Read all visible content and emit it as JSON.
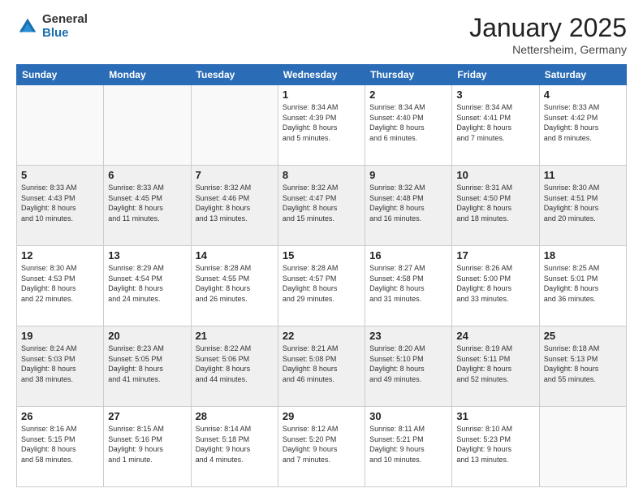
{
  "logo": {
    "general": "General",
    "blue": "Blue"
  },
  "title": {
    "month": "January 2025",
    "location": "Nettersheim, Germany"
  },
  "days_header": [
    "Sunday",
    "Monday",
    "Tuesday",
    "Wednesday",
    "Thursday",
    "Friday",
    "Saturday"
  ],
  "weeks": [
    {
      "alt": false,
      "days": [
        {
          "num": "",
          "info": ""
        },
        {
          "num": "",
          "info": ""
        },
        {
          "num": "",
          "info": ""
        },
        {
          "num": "1",
          "info": "Sunrise: 8:34 AM\nSunset: 4:39 PM\nDaylight: 8 hours\nand 5 minutes."
        },
        {
          "num": "2",
          "info": "Sunrise: 8:34 AM\nSunset: 4:40 PM\nDaylight: 8 hours\nand 6 minutes."
        },
        {
          "num": "3",
          "info": "Sunrise: 8:34 AM\nSunset: 4:41 PM\nDaylight: 8 hours\nand 7 minutes."
        },
        {
          "num": "4",
          "info": "Sunrise: 8:33 AM\nSunset: 4:42 PM\nDaylight: 8 hours\nand 8 minutes."
        }
      ]
    },
    {
      "alt": true,
      "days": [
        {
          "num": "5",
          "info": "Sunrise: 8:33 AM\nSunset: 4:43 PM\nDaylight: 8 hours\nand 10 minutes."
        },
        {
          "num": "6",
          "info": "Sunrise: 8:33 AM\nSunset: 4:45 PM\nDaylight: 8 hours\nand 11 minutes."
        },
        {
          "num": "7",
          "info": "Sunrise: 8:32 AM\nSunset: 4:46 PM\nDaylight: 8 hours\nand 13 minutes."
        },
        {
          "num": "8",
          "info": "Sunrise: 8:32 AM\nSunset: 4:47 PM\nDaylight: 8 hours\nand 15 minutes."
        },
        {
          "num": "9",
          "info": "Sunrise: 8:32 AM\nSunset: 4:48 PM\nDaylight: 8 hours\nand 16 minutes."
        },
        {
          "num": "10",
          "info": "Sunrise: 8:31 AM\nSunset: 4:50 PM\nDaylight: 8 hours\nand 18 minutes."
        },
        {
          "num": "11",
          "info": "Sunrise: 8:30 AM\nSunset: 4:51 PM\nDaylight: 8 hours\nand 20 minutes."
        }
      ]
    },
    {
      "alt": false,
      "days": [
        {
          "num": "12",
          "info": "Sunrise: 8:30 AM\nSunset: 4:53 PM\nDaylight: 8 hours\nand 22 minutes."
        },
        {
          "num": "13",
          "info": "Sunrise: 8:29 AM\nSunset: 4:54 PM\nDaylight: 8 hours\nand 24 minutes."
        },
        {
          "num": "14",
          "info": "Sunrise: 8:28 AM\nSunset: 4:55 PM\nDaylight: 8 hours\nand 26 minutes."
        },
        {
          "num": "15",
          "info": "Sunrise: 8:28 AM\nSunset: 4:57 PM\nDaylight: 8 hours\nand 29 minutes."
        },
        {
          "num": "16",
          "info": "Sunrise: 8:27 AM\nSunset: 4:58 PM\nDaylight: 8 hours\nand 31 minutes."
        },
        {
          "num": "17",
          "info": "Sunrise: 8:26 AM\nSunset: 5:00 PM\nDaylight: 8 hours\nand 33 minutes."
        },
        {
          "num": "18",
          "info": "Sunrise: 8:25 AM\nSunset: 5:01 PM\nDaylight: 8 hours\nand 36 minutes."
        }
      ]
    },
    {
      "alt": true,
      "days": [
        {
          "num": "19",
          "info": "Sunrise: 8:24 AM\nSunset: 5:03 PM\nDaylight: 8 hours\nand 38 minutes."
        },
        {
          "num": "20",
          "info": "Sunrise: 8:23 AM\nSunset: 5:05 PM\nDaylight: 8 hours\nand 41 minutes."
        },
        {
          "num": "21",
          "info": "Sunrise: 8:22 AM\nSunset: 5:06 PM\nDaylight: 8 hours\nand 44 minutes."
        },
        {
          "num": "22",
          "info": "Sunrise: 8:21 AM\nSunset: 5:08 PM\nDaylight: 8 hours\nand 46 minutes."
        },
        {
          "num": "23",
          "info": "Sunrise: 8:20 AM\nSunset: 5:10 PM\nDaylight: 8 hours\nand 49 minutes."
        },
        {
          "num": "24",
          "info": "Sunrise: 8:19 AM\nSunset: 5:11 PM\nDaylight: 8 hours\nand 52 minutes."
        },
        {
          "num": "25",
          "info": "Sunrise: 8:18 AM\nSunset: 5:13 PM\nDaylight: 8 hours\nand 55 minutes."
        }
      ]
    },
    {
      "alt": false,
      "days": [
        {
          "num": "26",
          "info": "Sunrise: 8:16 AM\nSunset: 5:15 PM\nDaylight: 8 hours\nand 58 minutes."
        },
        {
          "num": "27",
          "info": "Sunrise: 8:15 AM\nSunset: 5:16 PM\nDaylight: 9 hours\nand 1 minute."
        },
        {
          "num": "28",
          "info": "Sunrise: 8:14 AM\nSunset: 5:18 PM\nDaylight: 9 hours\nand 4 minutes."
        },
        {
          "num": "29",
          "info": "Sunrise: 8:12 AM\nSunset: 5:20 PM\nDaylight: 9 hours\nand 7 minutes."
        },
        {
          "num": "30",
          "info": "Sunrise: 8:11 AM\nSunset: 5:21 PM\nDaylight: 9 hours\nand 10 minutes."
        },
        {
          "num": "31",
          "info": "Sunrise: 8:10 AM\nSunset: 5:23 PM\nDaylight: 9 hours\nand 13 minutes."
        },
        {
          "num": "",
          "info": ""
        }
      ]
    }
  ]
}
